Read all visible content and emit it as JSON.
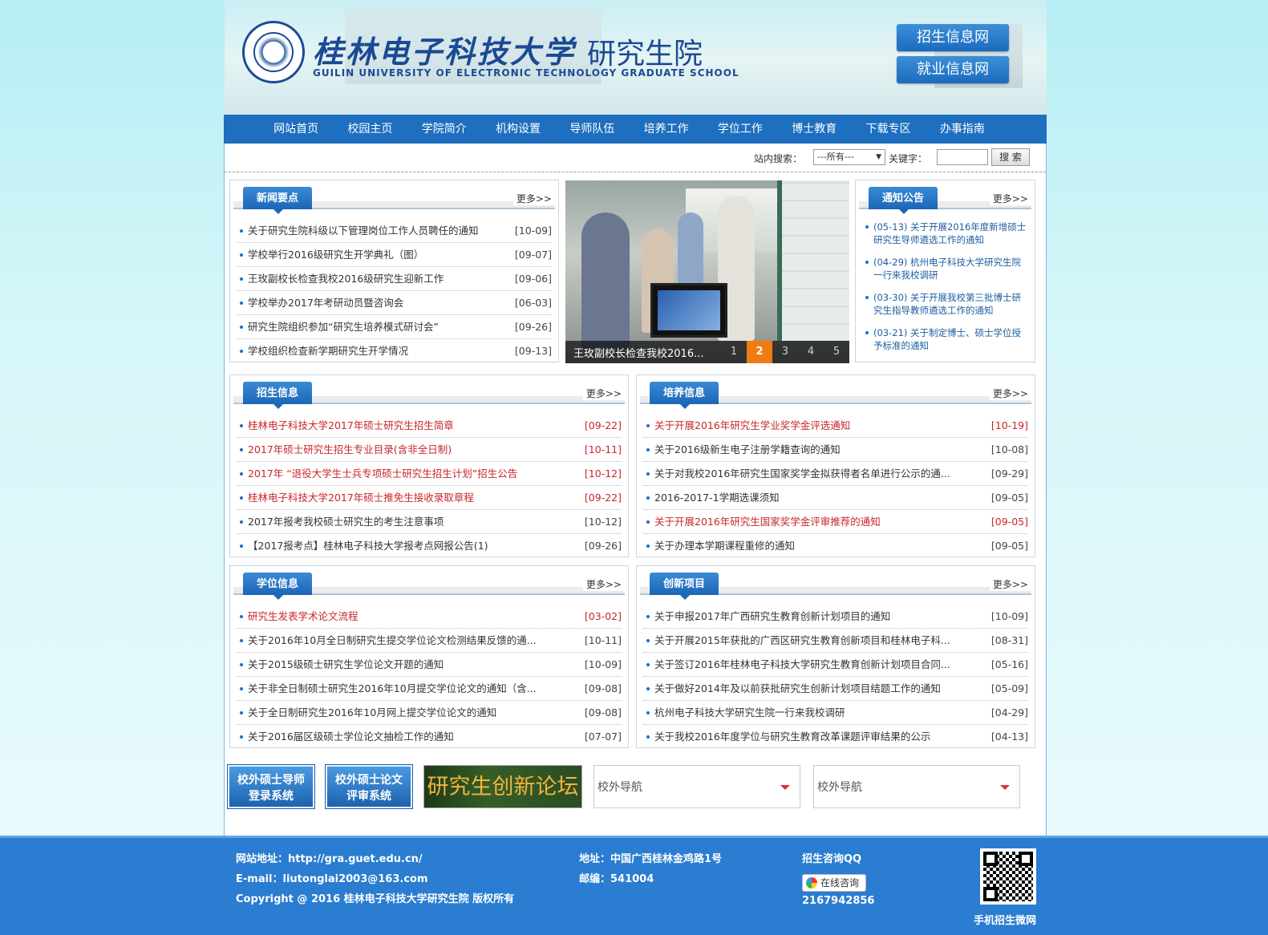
{
  "header": {
    "school_cn": "桂林电子科技大学",
    "school_cn_suffix": "研究生院",
    "school_en": "GUILIN UNIVERSITY OF ELECTRONIC TECHNOLOGY   GRADUATE SCHOOL",
    "btn_admission": "招生信息网",
    "btn_employment": "就业信息网"
  },
  "nav": [
    "网站首页",
    "校园主页",
    "学院简介",
    "机构设置",
    "导师队伍",
    "培养工作",
    "学位工作",
    "博士教育",
    "下载专区",
    "办事指南"
  ],
  "search": {
    "site_label": "站内搜索：",
    "select_value": "---所有---",
    "keyword_label": "关键字：",
    "button": "搜 索"
  },
  "more": "更多>>",
  "news": {
    "title": "新闻要点",
    "items": [
      {
        "t": "关于研究生院科级以下管理岗位工作人员聘任的通知",
        "d": "[10-09]"
      },
      {
        "t": "学校举行2016级研究生开学典礼（图）",
        "d": "[09-07]"
      },
      {
        "t": "王玫副校长检查我校2016级研究生迎新工作",
        "d": "[09-06]"
      },
      {
        "t": "学校举办2017年考研动员暨咨询会",
        "d": "[06-03]"
      },
      {
        "t": "研究生院组织参加“研究生培养模式研讨会”",
        "d": "[09-26]"
      },
      {
        "t": "学校组织检查新学期研究生开学情况",
        "d": "[09-13]"
      }
    ]
  },
  "slide": {
    "caption": "王玫副校长检查我校2016...",
    "pages": [
      "1",
      "2",
      "3",
      "4",
      "5"
    ],
    "active": 2
  },
  "notice": {
    "title": "通知公告",
    "items": [
      "(05-13) 关于开展2016年度新增硕士研究生导师遴选工作的通知",
      "(04-29) 杭州电子科技大学研究生院一行来我校调研",
      "(03-30) 关于开展我校第三批博士研究生指导教师遴选工作的通知",
      "(03-21) 关于制定博士、硕士学位授予标准的通知"
    ]
  },
  "admission": {
    "title": "招生信息",
    "items": [
      {
        "t": "桂林电子科技大学2017年硕士研究生招生简章",
        "d": "[09-22]",
        "red": true
      },
      {
        "t": "2017年硕士研究生招生专业目录(含非全日制)",
        "d": "[10-11]",
        "red": true
      },
      {
        "t": "2017年 “退役大学生士兵专项硕士研究生招生计划”招生公告",
        "d": "[10-12]",
        "red": true
      },
      {
        "t": "桂林电子科技大学2017年硕士推免生接收录取章程",
        "d": "[09-22]",
        "red": true
      },
      {
        "t": "2017年报考我校硕士研究生的考生注意事项",
        "d": "[10-12]",
        "red": false
      },
      {
        "t": "【2017报考点】桂林电子科技大学报考点网报公告(1)",
        "d": "[09-26]",
        "red": false
      }
    ]
  },
  "training": {
    "title": "培养信息",
    "items": [
      {
        "t": "关于开展2016年研究生学业奖学金评选通知",
        "d": "[10-19]",
        "red": true
      },
      {
        "t": "关于2016级新生电子注册学籍查询的通知",
        "d": "[10-08]",
        "red": false
      },
      {
        "t": "关于对我校2016年研究生国家奖学金拟获得者名单进行公示的通...",
        "d": "[09-29]",
        "red": false
      },
      {
        "t": "2016-2017-1学期选课须知",
        "d": "[09-05]",
        "red": false
      },
      {
        "t": "关于开展2016年研究生国家奖学金评审推荐的通知",
        "d": "[09-05]",
        "red": true
      },
      {
        "t": "关于办理本学期课程重修的通知",
        "d": "[09-05]",
        "red": false
      }
    ]
  },
  "degree": {
    "title": "学位信息",
    "items": [
      {
        "t": "研究生发表学术论文流程",
        "d": "[03-02]",
        "red": true
      },
      {
        "t": "关于2016年10月全日制研究生提交学位论文检测结果反馈的通...",
        "d": "[10-11]",
        "red": false
      },
      {
        "t": "关于2015级硕士研究生学位论文开题的通知",
        "d": "[10-09]",
        "red": false
      },
      {
        "t": "关于非全日制硕士研究生2016年10月提交学位论文的通知（含...",
        "d": "[09-08]",
        "red": false
      },
      {
        "t": "关于全日制研究生2016年10月网上提交学位论文的通知",
        "d": "[09-08]",
        "red": false
      },
      {
        "t": "关于2016届区级硕士学位论文抽检工作的通知",
        "d": "[07-07]",
        "red": false
      }
    ]
  },
  "innovation": {
    "title": "创新项目",
    "items": [
      {
        "t": "关于申报2017年广西研究生教育创新计划项目的通知",
        "d": "[10-09]",
        "red": false
      },
      {
        "t": "关于开展2015年获批的广西区研究生教育创新项目和桂林电子科...",
        "d": "[08-31]",
        "red": false
      },
      {
        "t": "关于签订2016年桂林电子科技大学研究生教育创新计划项目合同...",
        "d": "[05-16]",
        "red": false
      },
      {
        "t": "关于做好2014年及以前获批研究生创新计划项目结题工作的通知",
        "d": "[05-09]",
        "red": false
      },
      {
        "t": "杭州电子科技大学研究生院一行来我校调研",
        "d": "[04-29]",
        "red": false
      },
      {
        "t": "关于我校2016年度学位与研究生教育改革课题评审结果的公示",
        "d": "[04-13]",
        "red": false
      }
    ]
  },
  "quicklinks": {
    "tutor_login": [
      "校外硕士导师",
      "登录系统"
    ],
    "thesis_review": [
      "校外硕士论文",
      "评审系统"
    ],
    "forum": "研究生创新论坛",
    "nav1": "校外导航",
    "nav2": "校外导航"
  },
  "footer": {
    "site": "网站地址：http://gra.guet.edu.cn/",
    "email": "E-mail：liutonglai2003@163.com",
    "copyright": "Copyright @ 2016 桂林电子科技大学研究生院 版权所有",
    "address": "地址：中国广西桂林金鸡路1号",
    "zip": "邮编：541004",
    "qq_label": "招生咨询QQ",
    "qq_btn": "在线咨询",
    "qq_num": "2167942856",
    "qr_label": "手机招生微网"
  },
  "colors": {
    "primary": "#1e6fbf",
    "accent": "#f07b12",
    "red": "#c8262b"
  }
}
